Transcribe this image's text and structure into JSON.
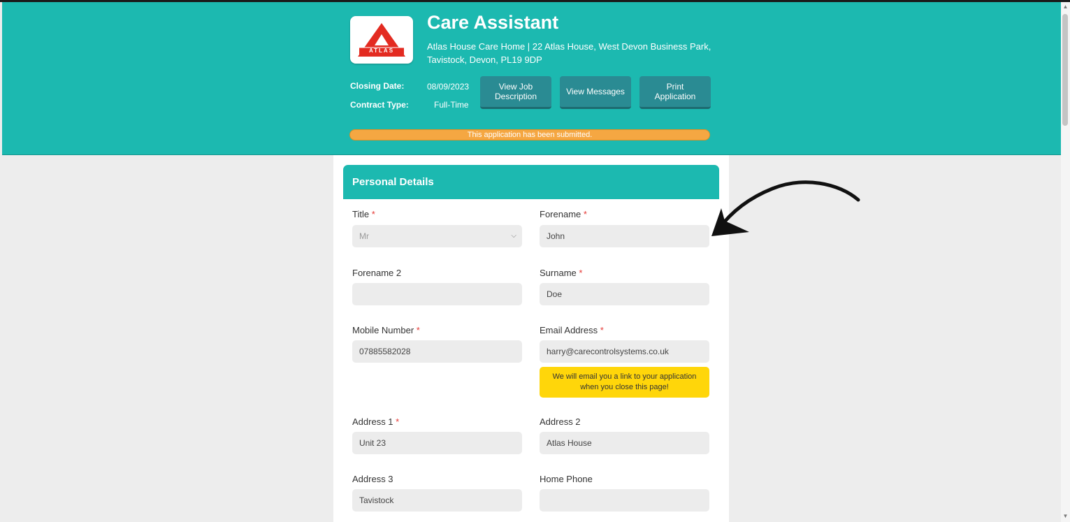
{
  "job": {
    "title": "Care Assistant",
    "address": "Atlas House Care Home | 22 Atlas House, West Devon Business Park, Tavistock, Devon, PL19 9DP",
    "logo_text": "ATLAS"
  },
  "meta": {
    "closing_label": "Closing Date:",
    "closing_value": "08/09/2023",
    "contract_label": "Contract Type:",
    "contract_value": "Full-Time"
  },
  "buttons": {
    "view_job": "View Job Description",
    "view_messages": "View Messages",
    "print": "Print Application"
  },
  "status": "This application has been submitted.",
  "section": {
    "title": "Personal Details"
  },
  "fields": {
    "title": {
      "label": "Title",
      "value": "Mr"
    },
    "forename": {
      "label": "Forename",
      "value": "John"
    },
    "forename2": {
      "label": "Forename 2",
      "value": ""
    },
    "surname": {
      "label": "Surname",
      "value": "Doe"
    },
    "mobile": {
      "label": "Mobile Number",
      "value": "07885582028"
    },
    "email": {
      "label": "Email Address",
      "value": "harry@carecontrolsystems.co.uk"
    },
    "address1": {
      "label": "Address 1",
      "value": "Unit 23"
    },
    "address2": {
      "label": "Address 2",
      "value": "Atlas House"
    },
    "address3": {
      "label": "Address 3",
      "value": "Tavistock"
    },
    "home_phone": {
      "label": "Home Phone",
      "value": ""
    }
  },
  "email_notice": "We will email you a link to your application when you close this page!",
  "colors": {
    "header": "#1cb9b0",
    "status": "#f5a742",
    "notice": "#ffd60a",
    "required": "#e53935"
  }
}
